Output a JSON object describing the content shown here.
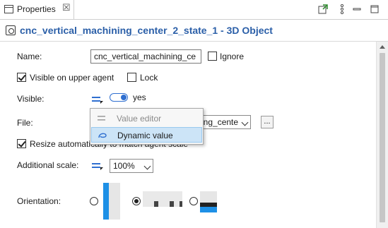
{
  "tab": {
    "title": "Properties",
    "close_glyph": "☒"
  },
  "view_buttons": [
    "open-in-new-icon",
    "more-vertical-icon",
    "minimize-icon",
    "maximize-icon"
  ],
  "header": {
    "title": "cnc_vertical_machining_center_2_state_1 - 3D Object",
    "icon": "object-3d-icon"
  },
  "form": {
    "name_label": "Name:",
    "name_value": "cnc_vertical_machining_ce",
    "ignore_label": "Ignore",
    "ignore_checked": false,
    "visible_upper_label": "Visible on upper agent",
    "visible_upper_checked": true,
    "lock_label": "Lock",
    "lock_checked": false,
    "visible_label": "Visible:",
    "visible_value": "yes",
    "file_label": "File:",
    "file_value": "ing_cente",
    "file_browse_label": "...",
    "resize_label": "Resize automatically to match agent scale",
    "resize_checked": true,
    "additional_scale_label": "Additional scale:",
    "additional_scale_value": "100%",
    "orientation_label": "Orientation:",
    "orientation_selected_index": 1
  },
  "popup_menu": {
    "items": [
      {
        "label": "Value editor",
        "enabled": false,
        "icon": "equals-icon"
      },
      {
        "label": "Dynamic value",
        "enabled": true,
        "selected": true,
        "icon": "dynamic-value-icon"
      }
    ]
  },
  "colors": {
    "title": "#2b5fa8",
    "accent": "#2f6fd0",
    "selection": "#cce4f7",
    "thumb_blue": "#1e90e6"
  }
}
